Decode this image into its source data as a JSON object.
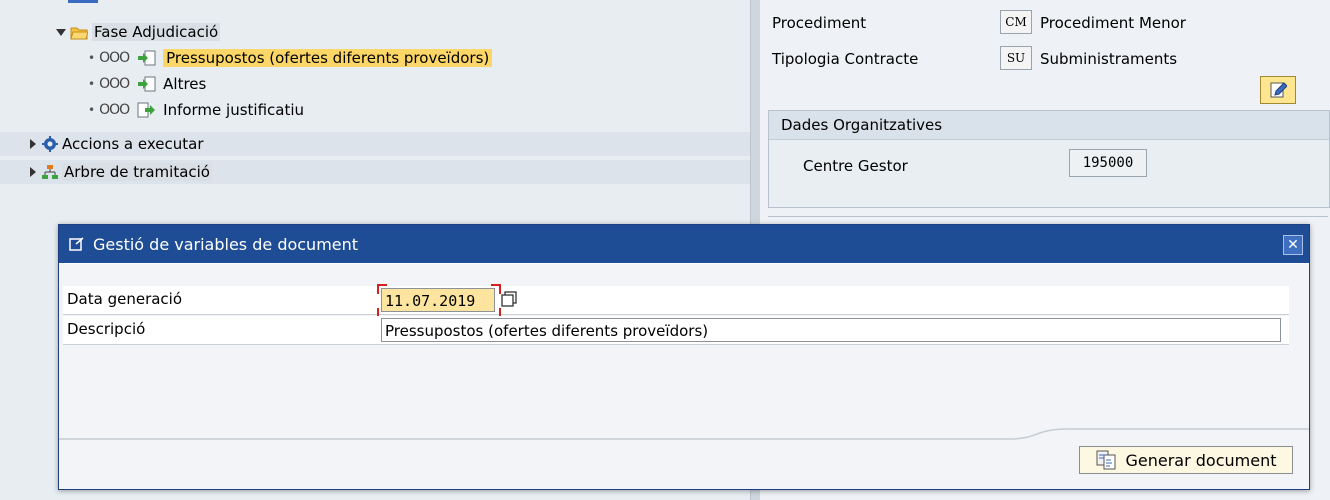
{
  "tree": {
    "phase_label": "Fase Adjudicació",
    "items": [
      {
        "status": "ООО",
        "label": "Pressupostos (ofertes diferents proveïdors)",
        "selected": true
      },
      {
        "status": "ООО",
        "label": "Altres",
        "selected": false
      },
      {
        "status": "ООО",
        "label": "Informe justificatiu",
        "selected": false
      }
    ],
    "actions_label": "Accions a executar",
    "flow_label": "Arbre de tramitació"
  },
  "form": {
    "procediment_label": "Procediment",
    "procediment_code": "CM",
    "procediment_value": "Procediment Menor",
    "tipologia_label": "Tipologia Contracte",
    "tipologia_code": "SU",
    "tipologia_value": "Subministraments",
    "org_group_title": "Dades Organitzatives",
    "centre_label": "Centre Gestor",
    "centre_value": "195000"
  },
  "dialog": {
    "title": "Gestió de variables de document",
    "date_label": "Data generació",
    "date_value": "11.07.2019",
    "desc_label": "Descripció",
    "desc_value": "Pressupostos (ofertes diferents proveïdors)",
    "generate_label": "Generar document"
  },
  "colors": {
    "title_bar": "#1f4d95",
    "selection": "#fcd667",
    "required_field": "#fde5a0"
  }
}
